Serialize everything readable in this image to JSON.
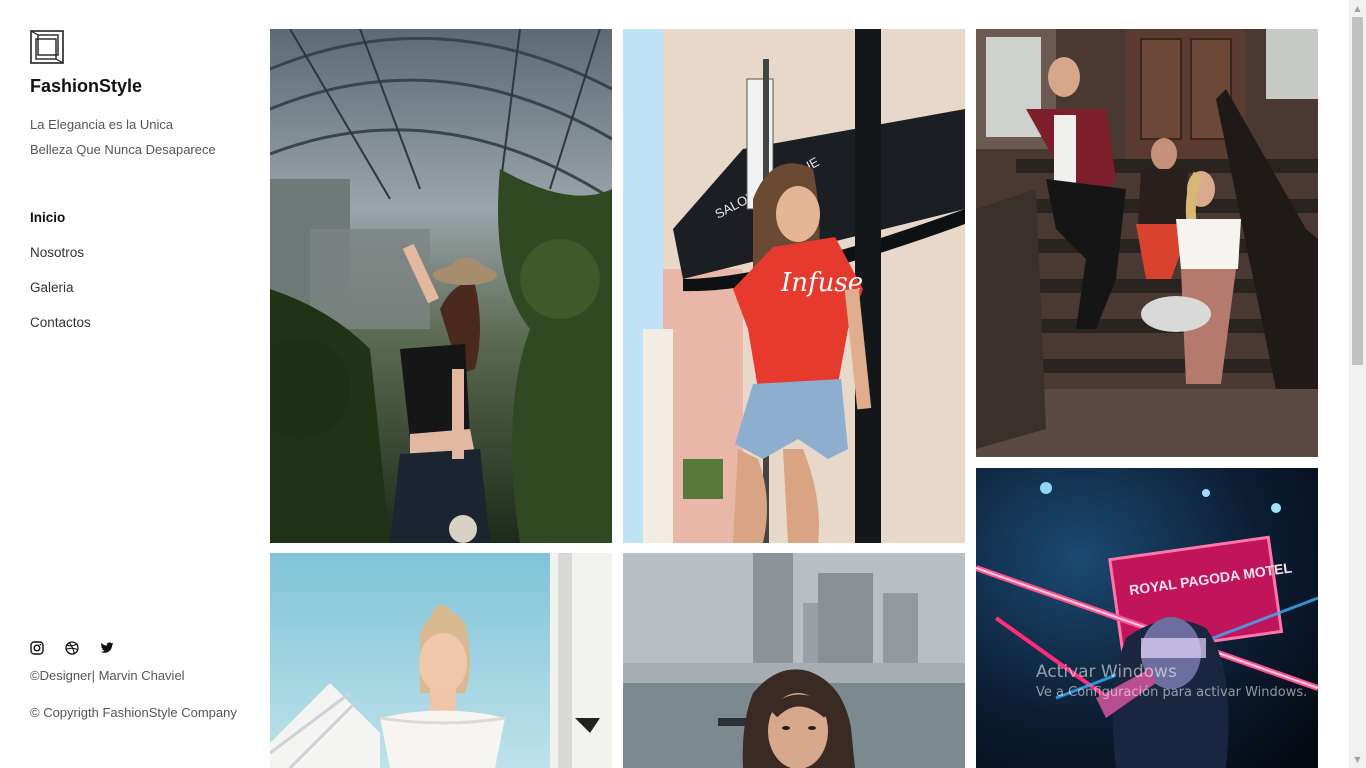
{
  "brand": {
    "logo_icon": "square-frame-logo-icon",
    "name": "FashionStyle",
    "tagline_line1": "La Elegancia es la Unica",
    "tagline_line2": "Belleza Que Nunca Desaparece"
  },
  "nav": {
    "items": [
      {
        "label": "Inicio",
        "active": true
      },
      {
        "label": "Nosotros",
        "active": false
      },
      {
        "label": "Galeria",
        "active": false
      },
      {
        "label": "Contactos",
        "active": false
      }
    ]
  },
  "social": {
    "icons": [
      "instagram-icon",
      "dribbble-icon",
      "twitter-icon"
    ]
  },
  "footer": {
    "credit": "©Designer| Marvin Chaviel",
    "copyright": "© Copyrigth FashionStyle Company"
  },
  "gallery": {
    "photos": [
      {
        "name": "greenhouse-woman-hat-photo"
      },
      {
        "name": "woman-red-infuse-shirt-photo",
        "shirt_text": "Infuse"
      },
      {
        "name": "group-on-stairs-photo"
      },
      {
        "name": "neon-motel-woman-photo",
        "sign_text": "ROYAL PAGODA MOTEL"
      },
      {
        "name": "woman-white-offshoulder-photo"
      },
      {
        "name": "woman-city-skyline-photo"
      }
    ]
  },
  "watermark": {
    "title": "Activar Windows",
    "subtitle": "Ve a Configuración para activar Windows."
  },
  "colors": {
    "text": "#222222",
    "muted": "#555555",
    "background": "#ffffff"
  }
}
